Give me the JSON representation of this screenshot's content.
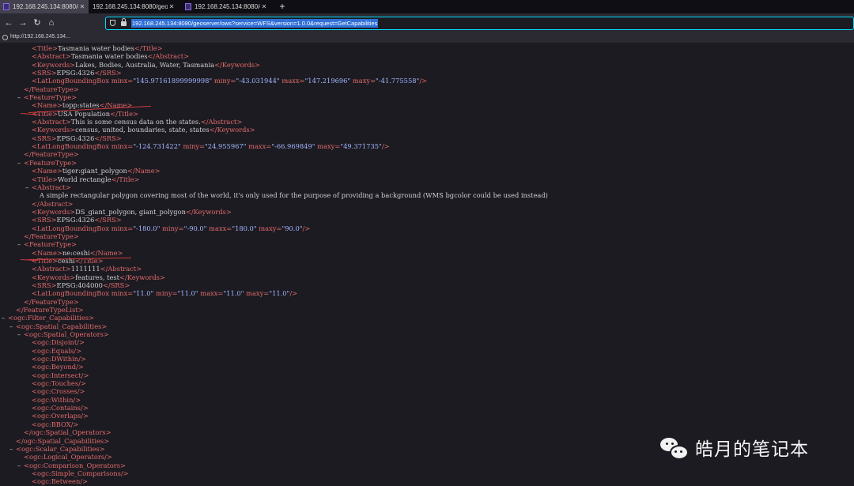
{
  "tabs": [
    {
      "label": "192.168.245.134:8080/gc",
      "close": "✕"
    },
    {
      "label": "192.168.245.134:8080/geose",
      "close": "✕"
    },
    {
      "label": "192.168.245.134:8080/gc",
      "close": "✕"
    }
  ],
  "new_tab": "+",
  "nav": {
    "back": "←",
    "forward": "→",
    "reload": "↻",
    "home": "⌂"
  },
  "url": "192.168.245.134:8080/geoserver/ows?service=WFS&version=1.0.0&request=GetCapabilities",
  "bookmark": "http://192.168.245.134...",
  "xml_lines": [
    {
      "i": 2,
      "t": "",
      "p": [
        [
          "tg",
          "<Title>"
        ],
        [
          "tx",
          "Tasmania water bodies"
        ],
        [
          "tg",
          "</Title>"
        ]
      ]
    },
    {
      "i": 2,
      "t": "",
      "p": [
        [
          "tg",
          "<Abstract>"
        ],
        [
          "tx",
          "Tasmania water bodies"
        ],
        [
          "tg",
          "</Abstract>"
        ]
      ]
    },
    {
      "i": 2,
      "t": "",
      "p": [
        [
          "tg",
          "<Keywords>"
        ],
        [
          "tx",
          "Lakes, Bodies, Australia, Water, Tasmania"
        ],
        [
          "tg",
          "</Keywords>"
        ]
      ]
    },
    {
      "i": 2,
      "t": "",
      "p": [
        [
          "tg",
          "<SRS>"
        ],
        [
          "tx",
          "EPSG:4326"
        ],
        [
          "tg",
          "</SRS>"
        ]
      ]
    },
    {
      "i": 2,
      "t": "",
      "p": [
        [
          "tg",
          "<LatLongBoundingBox "
        ],
        [
          "tg",
          "minx="
        ],
        [
          "av",
          "\"145.97161899999998\""
        ],
        [
          "tg",
          " miny="
        ],
        [
          "av",
          "\"-43.031944\""
        ],
        [
          "tg",
          " maxx="
        ],
        [
          "av",
          "\"147.219696\""
        ],
        [
          "tg",
          " maxy="
        ],
        [
          "av",
          "\"-41.775558\""
        ],
        [
          "tg",
          "/>"
        ]
      ]
    },
    {
      "i": 1,
      "t": "",
      "p": [
        [
          "tg",
          "</FeatureType>"
        ]
      ]
    },
    {
      "i": 1,
      "t": "–",
      "p": [
        [
          "tg",
          "<FeatureType>"
        ]
      ]
    },
    {
      "i": 2,
      "t": "",
      "p": [
        [
          "tg",
          "<Name>"
        ],
        [
          "tx",
          "topp:states"
        ],
        [
          "tg",
          "</Name>"
        ]
      ]
    },
    {
      "i": 2,
      "t": "",
      "p": [
        [
          "tg",
          "<Title>"
        ],
        [
          "tx",
          "USA Population"
        ],
        [
          "tg",
          "</Title>"
        ]
      ]
    },
    {
      "i": 2,
      "t": "",
      "p": [
        [
          "tg",
          "<Abstract>"
        ],
        [
          "tx",
          "This is some census data on the states."
        ],
        [
          "tg",
          "</Abstract>"
        ]
      ]
    },
    {
      "i": 2,
      "t": "",
      "p": [
        [
          "tg",
          "<Keywords>"
        ],
        [
          "tx",
          "census, united, boundaries, state, states"
        ],
        [
          "tg",
          "</Keywords>"
        ]
      ]
    },
    {
      "i": 2,
      "t": "",
      "p": [
        [
          "tg",
          "<SRS>"
        ],
        [
          "tx",
          "EPSG:4326"
        ],
        [
          "tg",
          "</SRS>"
        ]
      ]
    },
    {
      "i": 2,
      "t": "",
      "p": [
        [
          "tg",
          "<LatLongBoundingBox "
        ],
        [
          "tg",
          "minx="
        ],
        [
          "av",
          "\"-124.731422\""
        ],
        [
          "tg",
          " miny="
        ],
        [
          "av",
          "\"24.955967\""
        ],
        [
          "tg",
          " maxx="
        ],
        [
          "av",
          "\"-66.969849\""
        ],
        [
          "tg",
          " maxy="
        ],
        [
          "av",
          "\"49.371735\""
        ],
        [
          "tg",
          "/>"
        ]
      ]
    },
    {
      "i": 1,
      "t": "",
      "p": [
        [
          "tg",
          "</FeatureType>"
        ]
      ]
    },
    {
      "i": 1,
      "t": "–",
      "p": [
        [
          "tg",
          "<FeatureType>"
        ]
      ]
    },
    {
      "i": 2,
      "t": "",
      "p": [
        [
          "tg",
          "<Name>"
        ],
        [
          "tx",
          "tiger:giant_polygon"
        ],
        [
          "tg",
          "</Name>"
        ]
      ]
    },
    {
      "i": 2,
      "t": "",
      "p": [
        [
          "tg",
          "<Title>"
        ],
        [
          "tx",
          "World rectangle"
        ],
        [
          "tg",
          "</Title>"
        ]
      ]
    },
    {
      "i": 2,
      "t": "–",
      "p": [
        [
          "tg",
          "<Abstract>"
        ]
      ]
    },
    {
      "i": 3,
      "t": "",
      "p": [
        [
          "tx",
          "A simple rectangular polygon covering most of the world, it's only used for the purpose of providing a background (WMS bgcolor could be used instead)"
        ]
      ]
    },
    {
      "i": 2,
      "t": "",
      "p": [
        [
          "tg",
          "</Abstract>"
        ]
      ]
    },
    {
      "i": 2,
      "t": "",
      "p": [
        [
          "tg",
          "<Keywords>"
        ],
        [
          "tx",
          "DS_giant_polygon, giant_polygon"
        ],
        [
          "tg",
          "</Keywords>"
        ]
      ]
    },
    {
      "i": 2,
      "t": "",
      "p": [
        [
          "tg",
          "<SRS>"
        ],
        [
          "tx",
          "EPSG:4326"
        ],
        [
          "tg",
          "</SRS>"
        ]
      ]
    },
    {
      "i": 2,
      "t": "",
      "p": [
        [
          "tg",
          "<LatLongBoundingBox "
        ],
        [
          "tg",
          "minx="
        ],
        [
          "av",
          "\"-180.0\""
        ],
        [
          "tg",
          " miny="
        ],
        [
          "av",
          "\"-90.0\""
        ],
        [
          "tg",
          " maxx="
        ],
        [
          "av",
          "\"180.0\""
        ],
        [
          "tg",
          " maxy="
        ],
        [
          "av",
          "\"90.0\""
        ],
        [
          "tg",
          "/>"
        ]
      ]
    },
    {
      "i": 1,
      "t": "",
      "p": [
        [
          "tg",
          "</FeatureType>"
        ]
      ]
    },
    {
      "i": 1,
      "t": "–",
      "p": [
        [
          "tg",
          "<FeatureType>"
        ]
      ]
    },
    {
      "i": 2,
      "t": "",
      "p": [
        [
          "tg",
          "<Name>"
        ],
        [
          "tx",
          "ne:ceshi"
        ],
        [
          "tg",
          "</Name>"
        ]
      ]
    },
    {
      "i": 2,
      "t": "",
      "p": [
        [
          "tg",
          "<Title>"
        ],
        [
          "tx",
          "ceshi"
        ],
        [
          "tg",
          "</Title>"
        ]
      ]
    },
    {
      "i": 2,
      "t": "",
      "p": [
        [
          "tg",
          "<Abstract>"
        ],
        [
          "tx",
          "1111111"
        ],
        [
          "tg",
          "</Abstract>"
        ]
      ]
    },
    {
      "i": 2,
      "t": "",
      "p": [
        [
          "tg",
          "<Keywords>"
        ],
        [
          "tx",
          "features, test"
        ],
        [
          "tg",
          "</Keywords>"
        ]
      ]
    },
    {
      "i": 2,
      "t": "",
      "p": [
        [
          "tg",
          "<SRS>"
        ],
        [
          "tx",
          "EPSG:404000"
        ],
        [
          "tg",
          "</SRS>"
        ]
      ]
    },
    {
      "i": 2,
      "t": "",
      "p": [
        [
          "tg",
          "<LatLongBoundingBox "
        ],
        [
          "tg",
          "minx="
        ],
        [
          "av",
          "\"11.0\""
        ],
        [
          "tg",
          " miny="
        ],
        [
          "av",
          "\"11.0\""
        ],
        [
          "tg",
          " maxx="
        ],
        [
          "av",
          "\"11.0\""
        ],
        [
          "tg",
          " maxy="
        ],
        [
          "av",
          "\"11.0\""
        ],
        [
          "tg",
          "/>"
        ]
      ]
    },
    {
      "i": 1,
      "t": "",
      "p": [
        [
          "tg",
          "</FeatureType>"
        ]
      ]
    },
    {
      "i": 0,
      "t": "",
      "p": [
        [
          "tg",
          "</FeatureTypeList>"
        ]
      ]
    },
    {
      "i": -1,
      "t": "–",
      "p": [
        [
          "tg",
          "<ogc:Filter_Capabilities>"
        ]
      ]
    },
    {
      "i": 0,
      "t": "–",
      "p": [
        [
          "tg",
          "<ogc:Spatial_Capabilities>"
        ]
      ]
    },
    {
      "i": 1,
      "t": "–",
      "p": [
        [
          "tg",
          "<ogc:Spatial_Operators>"
        ]
      ]
    },
    {
      "i": 2,
      "t": "",
      "p": [
        [
          "tg",
          "<ogc:Disjoint/>"
        ]
      ]
    },
    {
      "i": 2,
      "t": "",
      "p": [
        [
          "tg",
          "<ogc:Equals/>"
        ]
      ]
    },
    {
      "i": 2,
      "t": "",
      "p": [
        [
          "tg",
          "<ogc:DWithin/>"
        ]
      ]
    },
    {
      "i": 2,
      "t": "",
      "p": [
        [
          "tg",
          "<ogc:Beyond/>"
        ]
      ]
    },
    {
      "i": 2,
      "t": "",
      "p": [
        [
          "tg",
          "<ogc:Intersect/>"
        ]
      ]
    },
    {
      "i": 2,
      "t": "",
      "p": [
        [
          "tg",
          "<ogc:Touches/>"
        ]
      ]
    },
    {
      "i": 2,
      "t": "",
      "p": [
        [
          "tg",
          "<ogc:Crosses/>"
        ]
      ]
    },
    {
      "i": 2,
      "t": "",
      "p": [
        [
          "tg",
          "<ogc:Within/>"
        ]
      ]
    },
    {
      "i": 2,
      "t": "",
      "p": [
        [
          "tg",
          "<ogc:Contains/>"
        ]
      ]
    },
    {
      "i": 2,
      "t": "",
      "p": [
        [
          "tg",
          "<ogc:Overlaps/>"
        ]
      ]
    },
    {
      "i": 2,
      "t": "",
      "p": [
        [
          "tg",
          "<ogc:BBOX/>"
        ]
      ]
    },
    {
      "i": 1,
      "t": "",
      "p": [
        [
          "tg",
          "</ogc:Spatial_Operators>"
        ]
      ]
    },
    {
      "i": 0,
      "t": "",
      "p": [
        [
          "tg",
          "</ogc:Spatial_Capabilities>"
        ]
      ]
    },
    {
      "i": 0,
      "t": "–",
      "p": [
        [
          "tg",
          "<ogc:Scalar_Capabilities>"
        ]
      ]
    },
    {
      "i": 1,
      "t": "",
      "p": [
        [
          "tg",
          "<ogc:Logical_Operators/>"
        ]
      ]
    },
    {
      "i": 1,
      "t": "–",
      "p": [
        [
          "tg",
          "<ogc:Comparison_Operators>"
        ]
      ]
    },
    {
      "i": 2,
      "t": "",
      "p": [
        [
          "tg",
          "<ogc:Simple_Comparisons/>"
        ]
      ]
    },
    {
      "i": 2,
      "t": "",
      "p": [
        [
          "tg",
          "<ogc:Between/>"
        ]
      ]
    }
  ],
  "watermark": {
    "text": "皓月的笔记本",
    "icon": "wechat-icon"
  },
  "colors": {
    "tag": "#e26b6b",
    "attr_value": "#a3b7ff",
    "text": "#cfcfcf",
    "annotation": "#d03b3b",
    "url_highlight": "#2f6fd6"
  }
}
